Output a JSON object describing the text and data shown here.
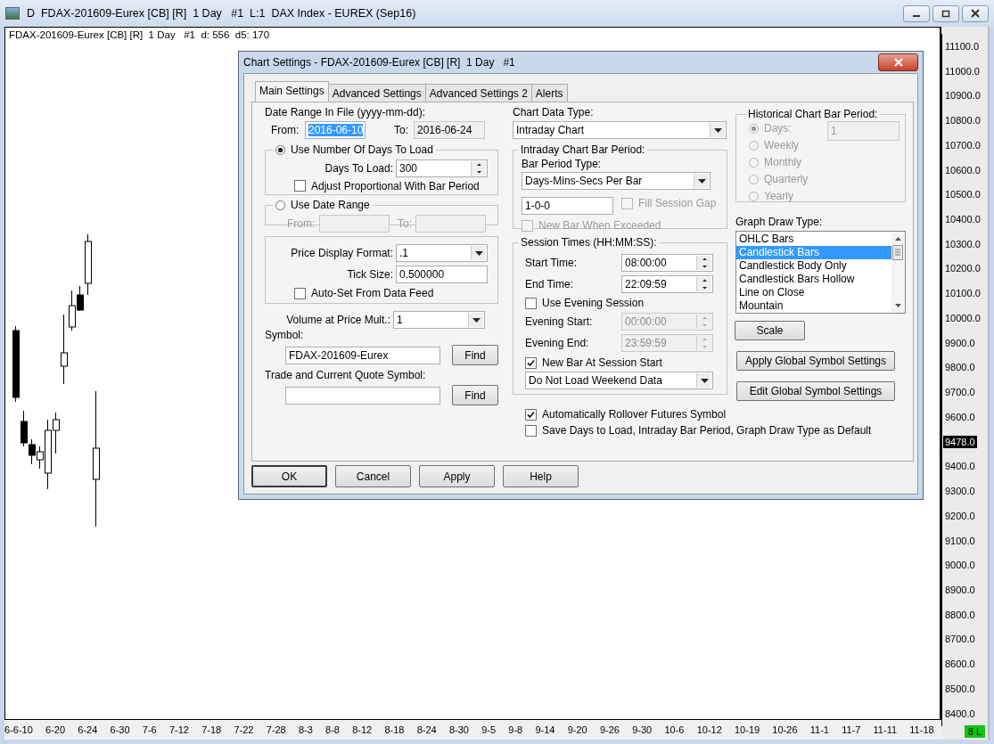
{
  "window": {
    "title": "D  FDAX-201609-Eurex [CB] [R]  1 Day   #1  L:1  DAX Index - EUREX (Sep16)"
  },
  "chart": {
    "header": "FDAX-201609-Eurex [CB] [R]  1 Day   #1  d: 556  d5: 170",
    "price_labels": [
      {
        "label": "11100.0",
        "kind": "tick"
      },
      {
        "label": "11000.0",
        "kind": "tick"
      },
      {
        "label": "10900.0",
        "kind": "tick"
      },
      {
        "label": "10800.0",
        "kind": "tick"
      },
      {
        "label": "10700.0",
        "kind": "tick"
      },
      {
        "label": "10600.0",
        "kind": "tick"
      },
      {
        "label": "10500.0",
        "kind": "tick"
      },
      {
        "label": "10400.0",
        "kind": "tick"
      },
      {
        "label": "10300.0",
        "kind": "tick"
      },
      {
        "label": "10200.0",
        "kind": "tick"
      },
      {
        "label": "10100.0",
        "kind": "tick"
      },
      {
        "label": "10000.0",
        "kind": "tick"
      },
      {
        "label": "9900.0",
        "kind": "tick"
      },
      {
        "label": "9800.0",
        "kind": "tick"
      },
      {
        "label": "9700.0",
        "kind": "tick"
      },
      {
        "label": "9600.0",
        "kind": "tick"
      },
      {
        "label": "9478.0",
        "kind": "current"
      },
      {
        "label": "9400.0",
        "kind": "tick"
      },
      {
        "label": "9300.0",
        "kind": "tick"
      },
      {
        "label": "9200.0",
        "kind": "tick"
      },
      {
        "label": "9100.0",
        "kind": "tick"
      },
      {
        "label": "9000.0",
        "kind": "tick"
      },
      {
        "label": "8900.0",
        "kind": "tick"
      },
      {
        "label": "8800.0",
        "kind": "tick"
      },
      {
        "label": "8700.0",
        "kind": "tick"
      },
      {
        "label": "8600.0",
        "kind": "tick"
      },
      {
        "label": "8500.0",
        "kind": "tick"
      },
      {
        "label": "8400.0",
        "kind": "tick"
      }
    ],
    "date_labels": [
      "6-6-10",
      "6-20",
      "6-24",
      "6-30",
      "7-6",
      "7-12",
      "7-18",
      "7-22",
      "7-28",
      "8-3",
      "8-8",
      "8-12",
      "8-18",
      "8-24",
      "8-30",
      "9-5",
      "9-8",
      "9-14",
      "9-20",
      "9-26",
      "9-30",
      "10-6",
      "10-12",
      "10-19",
      "10-26",
      "11-1",
      "11-7",
      "11-11",
      "11-18"
    ],
    "status_badge": "8 L"
  },
  "dialog": {
    "title": "Chart Settings - FDAX-201609-Eurex [CB] [R]  1 Day   #1",
    "tabs": [
      {
        "label": "Main Settings",
        "selected": true
      },
      {
        "label": "Advanced Settings",
        "selected": false
      },
      {
        "label": "Advanced Settings 2",
        "selected": false
      },
      {
        "label": "Alerts",
        "selected": false
      }
    ],
    "date_range": {
      "label": "Date Range In File (yyyy-mm-dd):",
      "from_label": "From:",
      "from_value": "2016-06-10",
      "from_highlighted": true,
      "to_label": "To:",
      "to_value": "2016-06-24"
    },
    "load_mode": [
      {
        "label": "Use Number Of Days To Load",
        "selected": true
      },
      {
        "label": "Use Date Range",
        "selected": false
      }
    ],
    "days_to_load": {
      "label": "Days To Load:",
      "value": "300"
    },
    "adjust_proportional": {
      "label": "Adjust Proportional With Bar Period",
      "checked": false
    },
    "range_fields": {
      "from_label": "From:",
      "to_label": "To:",
      "disabled": true
    },
    "price_display_format": {
      "label": "Price Display Format:",
      "value": ".1"
    },
    "tick_size": {
      "label": "Tick Size:",
      "value": "0.500000"
    },
    "auto_set": {
      "label": "Auto-Set From Data Feed",
      "checked": false
    },
    "volume_mult": {
      "label": "Volume at Price Mult.:",
      "value": "1"
    },
    "symbol": {
      "label": "Symbol:",
      "value": "FDAX-201609-Eurex",
      "button": "Find"
    },
    "quote_symbol": {
      "label": "Trade and Current Quote Symbol:",
      "button": "Find"
    },
    "chart_data_type": {
      "label": "Chart Data Type:",
      "value": "Intraday Chart"
    },
    "intraday": {
      "title": "Intraday Chart Bar Period:",
      "type_label": "Bar Period Type:",
      "type_value": "Days-Mins-Secs Per Bar",
      "period_value": "1-0-0",
      "fill_session_gap": {
        "label": "Fill Session Gap",
        "checked": false,
        "disabled": true
      },
      "new_bar_exceeded": {
        "label": "New Bar When Exceeded",
        "checked": false,
        "disabled": true
      }
    },
    "session": {
      "title": "Session Times (HH:MM:SS):",
      "start": {
        "label": "Start Time:",
        "value": "08:00:00",
        "disabled": false
      },
      "end": {
        "label": "End Time:",
        "value": "22:09:59",
        "disabled": false
      },
      "use_evening": {
        "label": "Use Evening Session",
        "checked": false
      },
      "evening_start": {
        "label": "Evening Start:",
        "value": "00:00:00",
        "disabled": true
      },
      "evening_end": {
        "label": "Evening End:",
        "value": "23:59:59",
        "disabled": true
      },
      "new_bar_at_start": {
        "label": "New Bar At Session Start",
        "checked": true
      },
      "weekend": {
        "value": "Do Not Load Weekend Data"
      }
    },
    "options": [
      {
        "label": "Automatically Rollover Futures Symbol",
        "checked": true
      },
      {
        "label": "Save Days to Load, Intraday Bar Period, Graph Draw Type as Default",
        "checked": false
      }
    ],
    "historical": {
      "title": "Historical Chart Bar Period:",
      "disabled": true,
      "days_value": "1",
      "periods": [
        {
          "label": "Days:",
          "selected": true
        },
        {
          "label": "Weekly",
          "selected": false
        },
        {
          "label": "Monthly",
          "selected": false
        },
        {
          "label": "Quarterly",
          "selected": false
        },
        {
          "label": "Yearly",
          "selected": false
        }
      ]
    },
    "graph_draw_type": {
      "label": "Graph Draw Type:",
      "items": [
        {
          "label": "OHLC Bars",
          "selected": false
        },
        {
          "label": "Candlestick Bars",
          "selected": true
        },
        {
          "label": "Candlestick Body Only",
          "selected": false
        },
        {
          "label": "Candlestick Bars Hollow",
          "selected": false
        },
        {
          "label": "Line on Close",
          "selected": false
        },
        {
          "label": "Mountain",
          "selected": false
        }
      ]
    },
    "scale_button": "Scale",
    "global_buttons": [
      "Apply Global Symbol Settings",
      "Edit Global Symbol Settings"
    ],
    "buttons": [
      "OK",
      "Cancel",
      "Apply",
      "Help"
    ]
  }
}
